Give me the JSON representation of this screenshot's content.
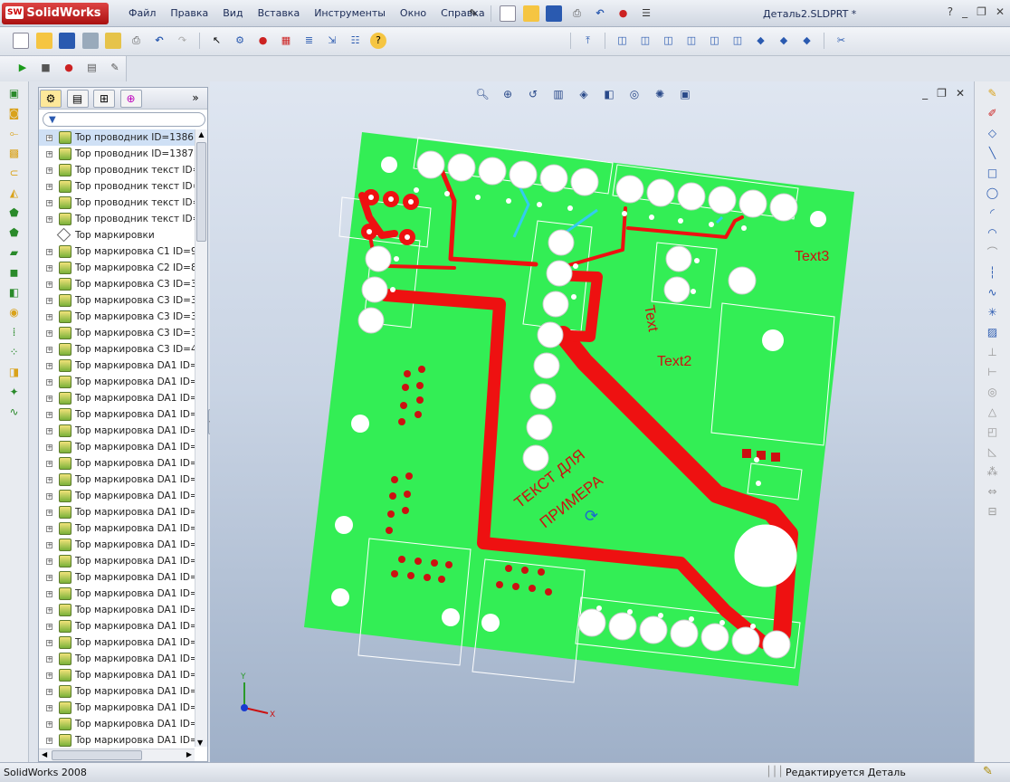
{
  "app": {
    "logo_text": "SolidWorks",
    "logo_badge": "SW",
    "document_title": "Деталь2.SLDPRT *"
  },
  "menu": [
    "Файл",
    "Правка",
    "Вид",
    "Вставка",
    "Инструменты",
    "Окно",
    "Справка"
  ],
  "feature_tree": {
    "items": [
      {
        "label": "Top  проводник ID=1386",
        "type": "sketch"
      },
      {
        "label": "Top  проводник ID=1387",
        "type": "sketch"
      },
      {
        "label": "Top  проводник текст ID=",
        "type": "sketch"
      },
      {
        "label": "Top  проводник текст ID=",
        "type": "sketch"
      },
      {
        "label": "Top  проводник текст ID=",
        "type": "sketch"
      },
      {
        "label": "Top  проводник текст ID=",
        "type": "sketch"
      },
      {
        "label": "Top маркировки",
        "type": "plane"
      },
      {
        "label": "Top  маркировка C1 ID=9",
        "type": "sketch"
      },
      {
        "label": "Top  маркировка C2 ID=8",
        "type": "sketch"
      },
      {
        "label": "Top  маркировка C3 ID=3",
        "type": "sketch"
      },
      {
        "label": "Top  маркировка C3 ID=3",
        "type": "sketch"
      },
      {
        "label": "Top  маркировка C3 ID=3",
        "type": "sketch"
      },
      {
        "label": "Top  маркировка C3 ID=3",
        "type": "sketch"
      },
      {
        "label": "Top  маркировка C3 ID=4",
        "type": "sketch"
      },
      {
        "label": "Top  маркировка DA1 ID=",
        "type": "sketch"
      },
      {
        "label": "Top  маркировка DA1 ID=",
        "type": "sketch"
      },
      {
        "label": "Top  маркировка DA1 ID=",
        "type": "sketch"
      },
      {
        "label": "Top  маркировка DA1 ID=",
        "type": "sketch"
      },
      {
        "label": "Top  маркировка DA1 ID=",
        "type": "sketch"
      },
      {
        "label": "Top  маркировка DA1 ID=",
        "type": "sketch"
      },
      {
        "label": "Top  маркировка DA1 ID=",
        "type": "sketch"
      },
      {
        "label": "Top  маркировка DA1 ID=",
        "type": "sketch"
      },
      {
        "label": "Top  маркировка DA1 ID=",
        "type": "sketch"
      },
      {
        "label": "Top  маркировка DA1 ID=",
        "type": "sketch"
      },
      {
        "label": "Top  маркировка DA1 ID=",
        "type": "sketch"
      },
      {
        "label": "Top  маркировка DA1 ID=",
        "type": "sketch"
      },
      {
        "label": "Top  маркировка DA1 ID=",
        "type": "sketch"
      },
      {
        "label": "Top  маркировка DA1 ID=",
        "type": "sketch"
      },
      {
        "label": "Top  маркировка DA1 ID=",
        "type": "sketch"
      },
      {
        "label": "Top  маркировка DA1 ID=",
        "type": "sketch"
      },
      {
        "label": "Top  маркировка DA1 ID=",
        "type": "sketch"
      },
      {
        "label": "Top  маркировка DA1 ID=",
        "type": "sketch"
      },
      {
        "label": "Top  маркировка DA1 ID=",
        "type": "sketch"
      },
      {
        "label": "Top  маркировка DA1 ID=",
        "type": "sketch"
      },
      {
        "label": "Top  маркировка DA1 ID=",
        "type": "sketch"
      },
      {
        "label": "Top  маркировка DA1 ID=",
        "type": "sketch"
      },
      {
        "label": "Top  маркировка DA1 ID=",
        "type": "sketch"
      },
      {
        "label": "Top  маркировка DA1 ID=",
        "type": "sketch"
      }
    ]
  },
  "board_text": {
    "t1": "Text",
    "t2": "Text2",
    "t3": "Text3",
    "t4": "ТЕКСТ ДЛЯ",
    "t5": "ПРИМЕРА"
  },
  "triad": {
    "x": "X",
    "y": "Y"
  },
  "status": {
    "left": "SolidWorks 2008",
    "right": "Редактируется Деталь"
  },
  "colors": {
    "board": "#33ee55",
    "trace": "#ee1111",
    "outline": "#ffffff",
    "teal_trace": "#33ccee"
  }
}
